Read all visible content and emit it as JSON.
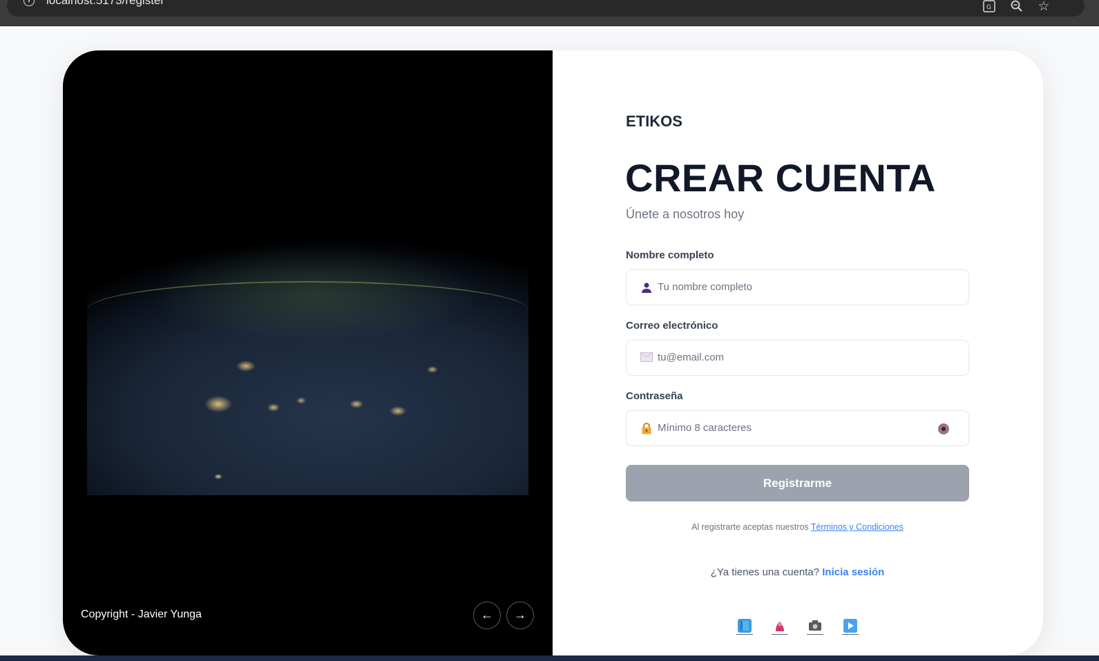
{
  "browser": {
    "url": "localhost:5173/register"
  },
  "left_panel": {
    "image_alt": "Earth at night from space",
    "copyright": "Copyright - Javier Yunga",
    "prev_label": "←",
    "next_label": "→"
  },
  "form": {
    "brand": "ETIKOS",
    "title": "CREAR CUENTA",
    "subtitle": "Únete a nosotros hoy",
    "fields": [
      {
        "label": "Nombre completo",
        "placeholder": "Tu nombre completo",
        "icon": "user-icon"
      },
      {
        "label": "Correo electrónico",
        "placeholder": "tu@email.com",
        "icon": "envelope-icon"
      },
      {
        "label": "Contraseña",
        "placeholder": "Mínimo 8 caracteres",
        "icon": "lock-icon"
      }
    ],
    "submit_label": "Registrarme",
    "terms_prefix": "Al registrarte aceptas nuestros",
    "terms_link": "Términos y Condiciones",
    "login_prompt": "¿Ya tienes una cuenta?",
    "login_link": "Inicia sesión",
    "social": [
      {
        "name": "book-icon",
        "color": "#3b9be0"
      },
      {
        "name": "flower-icon",
        "color": "#d6336c"
      },
      {
        "name": "camera-icon",
        "color": "#555555"
      },
      {
        "name": "play-icon",
        "color": "#2f80ed"
      }
    ]
  },
  "colors": {
    "primary_link": "#3b82f6",
    "button_disabled": "#9ca3af",
    "panel_dark": "#000000"
  }
}
